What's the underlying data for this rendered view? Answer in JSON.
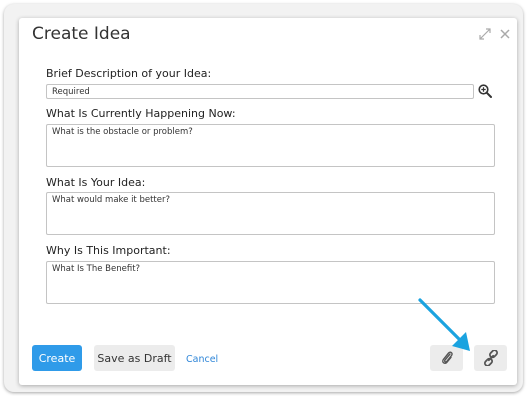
{
  "dialog": {
    "title": "Create Idea"
  },
  "form": {
    "brief_label": "Brief Description of your Idea:",
    "brief_placeholder": "Required",
    "happening_label": "What Is Currently Happening Now:",
    "happening_placeholder": "What is the obstacle or problem?",
    "idea_label": "What Is Your Idea:",
    "idea_placeholder": "What would make it better?",
    "important_label": "Why Is This Important:",
    "important_placeholder": "What Is The Benefit?"
  },
  "footer": {
    "create_label": "Create",
    "draft_label": "Save as Draft",
    "cancel_label": "Cancel"
  },
  "icons": {
    "expand": "expand-icon",
    "close": "close-icon",
    "zoom": "zoom-in-icon",
    "attach": "paperclip-icon",
    "link": "link-icon",
    "annotation_arrow": "arrow-icon"
  },
  "colors": {
    "primary": "#2f9be9",
    "link": "#2f86d8",
    "annotation": "#1aa3e0"
  }
}
